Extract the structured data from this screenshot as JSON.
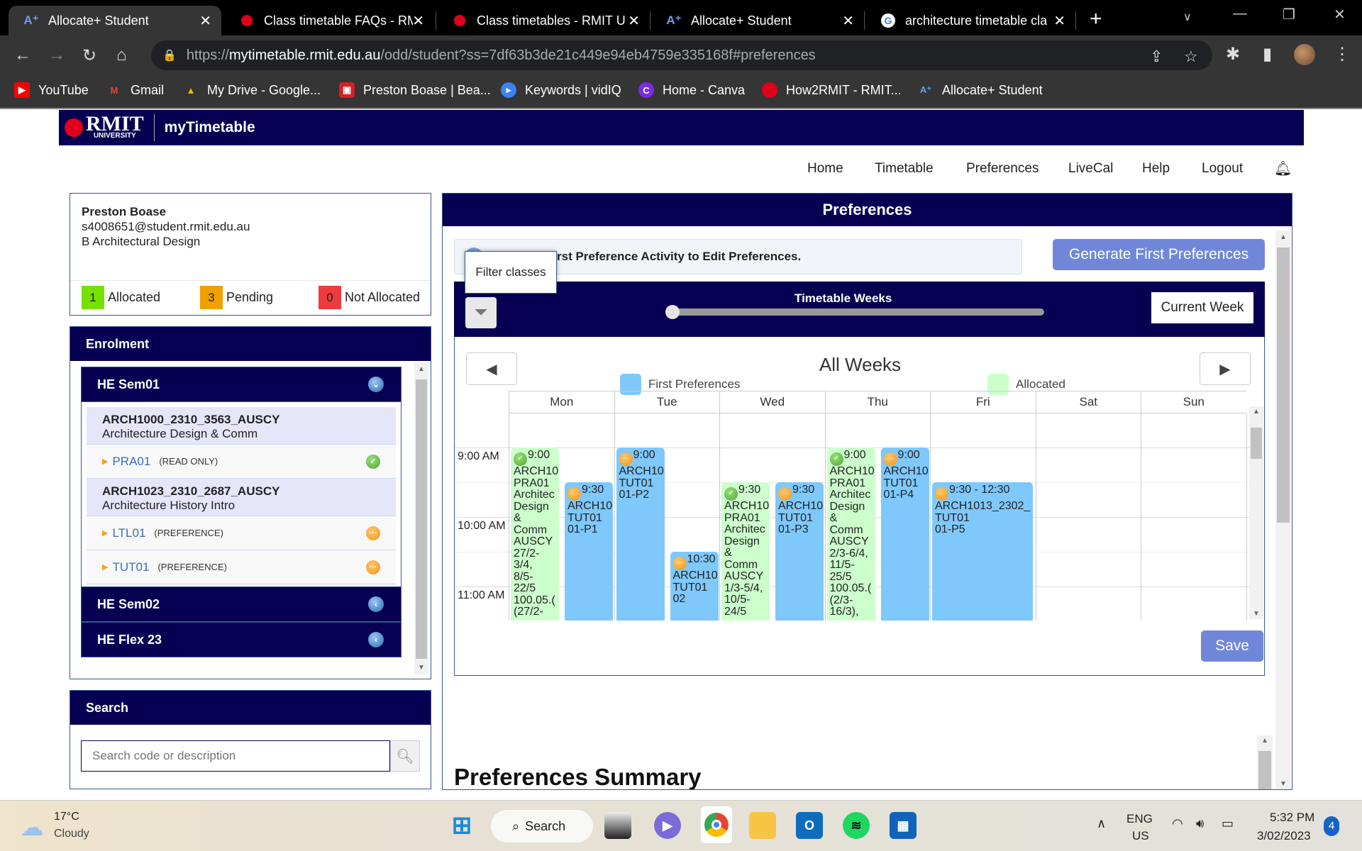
{
  "browser": {
    "tabs": [
      {
        "label": "Allocate+ Student",
        "icon": "allocate-plus-icon",
        "active": true
      },
      {
        "label": "Class timetable FAQs - RM",
        "icon": "rmit-icon"
      },
      {
        "label": "Class timetables - RMIT U",
        "icon": "rmit-icon"
      },
      {
        "label": "Allocate+ Student",
        "icon": "allocate-plus-icon"
      },
      {
        "label": "architecture timetable cla",
        "icon": "google-icon"
      }
    ],
    "url_prefix": "https://",
    "url_domain": "mytimetable.rmit.edu.au",
    "url_path": "/odd/student?ss=7df63b3de21c449e94eb4759e335168f#preferences",
    "bookmarks": [
      {
        "label": "YouTube",
        "icon": "youtube-icon",
        "color": "#ff0000"
      },
      {
        "label": "Gmail",
        "icon": "gmail-icon",
        "color": "#ea4335"
      },
      {
        "label": "My Drive - Google...",
        "icon": "google-drive-icon",
        "color": "#fbbc04"
      },
      {
        "label": "Preston Boase | Bea...",
        "icon": "behance-icon",
        "color": "#d42027"
      },
      {
        "label": "Keywords | vidIQ",
        "icon": "vidiq-icon",
        "color": "#3b82f6"
      },
      {
        "label": "Home - Canva",
        "icon": "canva-icon",
        "color": "#7d2ae8"
      },
      {
        "label": "How2RMIT - RMIT...",
        "icon": "rmit-icon",
        "color": "#e0001b"
      },
      {
        "label": "Allocate+ Student",
        "icon": "allocate-plus-icon",
        "color": "#4a7bd6"
      }
    ]
  },
  "app": {
    "logo_text": "RMIT",
    "logo_sub": "UNIVERSITY",
    "name": "myTimetable",
    "nav": [
      "Home",
      "Timetable",
      "Preferences",
      "LiveCal",
      "Help",
      "Logout"
    ]
  },
  "student": {
    "name": "Preston Boase",
    "email": "s4008651@student.rmit.edu.au",
    "program": "B Architectural Design",
    "badges": [
      {
        "count": "1",
        "label": "Allocated",
        "color": "#76e000"
      },
      {
        "count": "3",
        "label": "Pending",
        "color": "#f0a000"
      },
      {
        "count": "0",
        "label": "Not Allocated",
        "color": "#ee3b3b"
      }
    ]
  },
  "enrolment": {
    "title": "Enrolment",
    "semesters": [
      {
        "label": "HE Sem01",
        "expanded": true,
        "courses": [
          {
            "code": "ARCH1000_2310_3563_AUSCY",
            "title": "Architecture Design & Comm",
            "activities": [
              {
                "name": "PRA01",
                "type": "(READ ONLY)",
                "status": "allocated"
              }
            ]
          },
          {
            "code": "ARCH1023_2310_2687_AUSCY",
            "title": "Architecture History Intro",
            "activities": [
              {
                "name": "LTL01",
                "type": "(PREFERENCE)",
                "status": "pending"
              },
              {
                "name": "TUT01",
                "type": "(PREFERENCE)",
                "status": "pending"
              }
            ]
          }
        ]
      },
      {
        "label": "HE Sem02",
        "expanded": false
      },
      {
        "label": "HE Flex 23",
        "expanded": false
      }
    ]
  },
  "search": {
    "title": "Search",
    "placeholder": "Search code or description"
  },
  "preferences": {
    "title": "Preferences",
    "hint": "rst Preference Activity to Edit Preferences.",
    "tooltip": "Filter classes",
    "generate_label": "Generate First Preferences",
    "timetable_weeks_label": "Timetable Weeks",
    "week_slider_position": 0,
    "current_week_label": "Current Week",
    "week_title": "All Weeks",
    "legend": [
      {
        "label": "First Preferences",
        "color": "#7ec8fc"
      },
      {
        "label": "Allocated",
        "color": "#ccffcc"
      }
    ],
    "days": [
      "Mon",
      "Tue",
      "Wed",
      "Thu",
      "Fri",
      "Sat",
      "Sun"
    ],
    "time_labels": [
      "9:00 AM",
      "10:00 AM",
      "11:00 AM"
    ],
    "events": [
      {
        "day": 0,
        "lane": 0,
        "lanes": 2,
        "start": 9.0,
        "type": "alloc",
        "status": "allocated",
        "text": "9:00\nARCH10\nPRA01\nArchitec\nDesign\n&\nComm\nAUSCY\n27/2-\n3/4,\n8/5-\n22/5\n100.05.(\n(27/2-"
      },
      {
        "day": 0,
        "lane": 1,
        "lanes": 2,
        "start": 9.5,
        "type": "pref",
        "status": "pending",
        "text": "9:30\nARCH10\nTUT01\n01-P1"
      },
      {
        "day": 1,
        "lane": 0,
        "lanes": 2,
        "start": 9.0,
        "type": "pref",
        "status": "pending",
        "text": "9:00\nARCH10\nTUT01\n01-P2"
      },
      {
        "day": 1,
        "lane": 1,
        "lanes": 2,
        "start": 10.5,
        "type": "pref",
        "status": "pending",
        "text": "10:30\nARCH10\nTUT01\n02"
      },
      {
        "day": 2,
        "lane": 0,
        "lanes": 2,
        "start": 9.5,
        "type": "alloc",
        "status": "allocated",
        "text": "9:30\nARCH10\nPRA01\nArchitec\nDesign\n&\nComm\nAUSCY\n1/3-5/4,\n10/5-\n24/5"
      },
      {
        "day": 2,
        "lane": 1,
        "lanes": 2,
        "start": 9.5,
        "type": "pref",
        "status": "pending",
        "text": "9:30\nARCH10\nTUT01\n01-P3"
      },
      {
        "day": 3,
        "lane": 0,
        "lanes": 2,
        "start": 9.0,
        "type": "alloc",
        "status": "allocated",
        "text": "9:00\nARCH10\nPRA01\nArchitec\nDesign\n&\nComm\nAUSCY\n2/3-6/4,\n11/5-\n25/5\n100.05.(\n(2/3-\n16/3),"
      },
      {
        "day": 3,
        "lane": 1,
        "lanes": 2,
        "start": 9.0,
        "type": "pref",
        "status": "pending",
        "text": "9:00\nARCH10\nTUT01\n01-P4"
      },
      {
        "day": 4,
        "lane": 0,
        "lanes": 1,
        "start": 9.5,
        "type": "pref",
        "status": "pending",
        "text": "9:30 - 12:30\nARCH1013_2302_\nTUT01\n01-P5"
      }
    ],
    "save_label": "Save",
    "summary_title": "Preferences Summary"
  },
  "taskbar": {
    "weather_temp": "17°C",
    "weather_desc": "Cloudy",
    "search_label": "Search",
    "lang_top": "ENG",
    "lang_bottom": "US",
    "time": "5:32 PM",
    "date": "3/02/2023",
    "notification_count": "4"
  }
}
